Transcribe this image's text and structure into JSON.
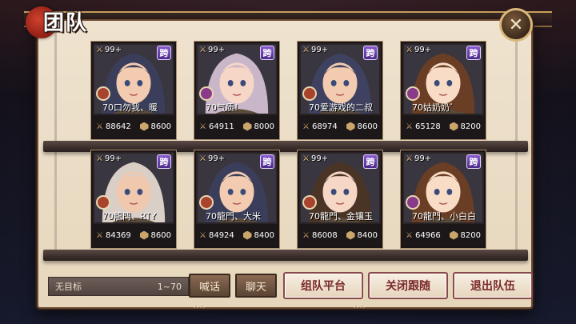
{
  "header": {
    "title": "团队",
    "close_label": "✕"
  },
  "cards": [
    {
      "level": "99+",
      "server": "跨",
      "name": "70口勿我、暖",
      "power": "88642",
      "limit": "8600",
      "class_color": "#a8442e",
      "hair": "#3a3e5a",
      "skin": "#f2cbb0"
    },
    {
      "level": "99+",
      "server": "跨",
      "name": "70气质!",
      "power": "64911",
      "limit": "8000",
      "class_color": "#8a3a8a",
      "hair": "#c9b6c8",
      "skin": "#f6d6c6"
    },
    {
      "level": "99+",
      "server": "跨",
      "name": "70爱游戏的二叔",
      "power": "68974",
      "limit": "8600",
      "class_color": "#a8442e",
      "hair": "#3e4260",
      "skin": "#f2cbb0"
    },
    {
      "level": "99+",
      "server": "跨",
      "name": "70姑奶奶゛",
      "power": "65128",
      "limit": "8200",
      "class_color": "#8a3a8a",
      "hair": "#6a3e24",
      "skin": "#f8dcc6"
    },
    {
      "level": "99+",
      "server": "跨",
      "name": "70龍門、RTY",
      "power": "84369",
      "limit": "8600",
      "class_color": "#a8442e",
      "hair": "#d9cfc7",
      "skin": "#f0c8ae"
    },
    {
      "level": "99+",
      "server": "跨",
      "name": "70龍門、大米",
      "power": "84924",
      "limit": "8400",
      "class_color": "#a8442e",
      "hair": "#3a3e5a",
      "skin": "#f2cbb0"
    },
    {
      "level": "99+",
      "server": "跨",
      "name": "70龍門、金镶玉",
      "power": "86008",
      "limit": "8400",
      "class_color": "#a8442e",
      "hair": "#4a3426",
      "skin": "#f6d6c4"
    },
    {
      "level": "99+",
      "server": "跨",
      "name": "70龍門、小白白",
      "power": "64966",
      "limit": "8200",
      "class_color": "#8a3a8a",
      "hair": "#6a3e24",
      "skin": "#f8dcc6"
    }
  ],
  "footer": {
    "target": "无目标",
    "range": "1~70",
    "shout_label": "喊话",
    "chat_label": "聊天",
    "platform_label": "组队平台",
    "close_follow_label": "关闭跟随",
    "leave_label": "退出队伍"
  }
}
